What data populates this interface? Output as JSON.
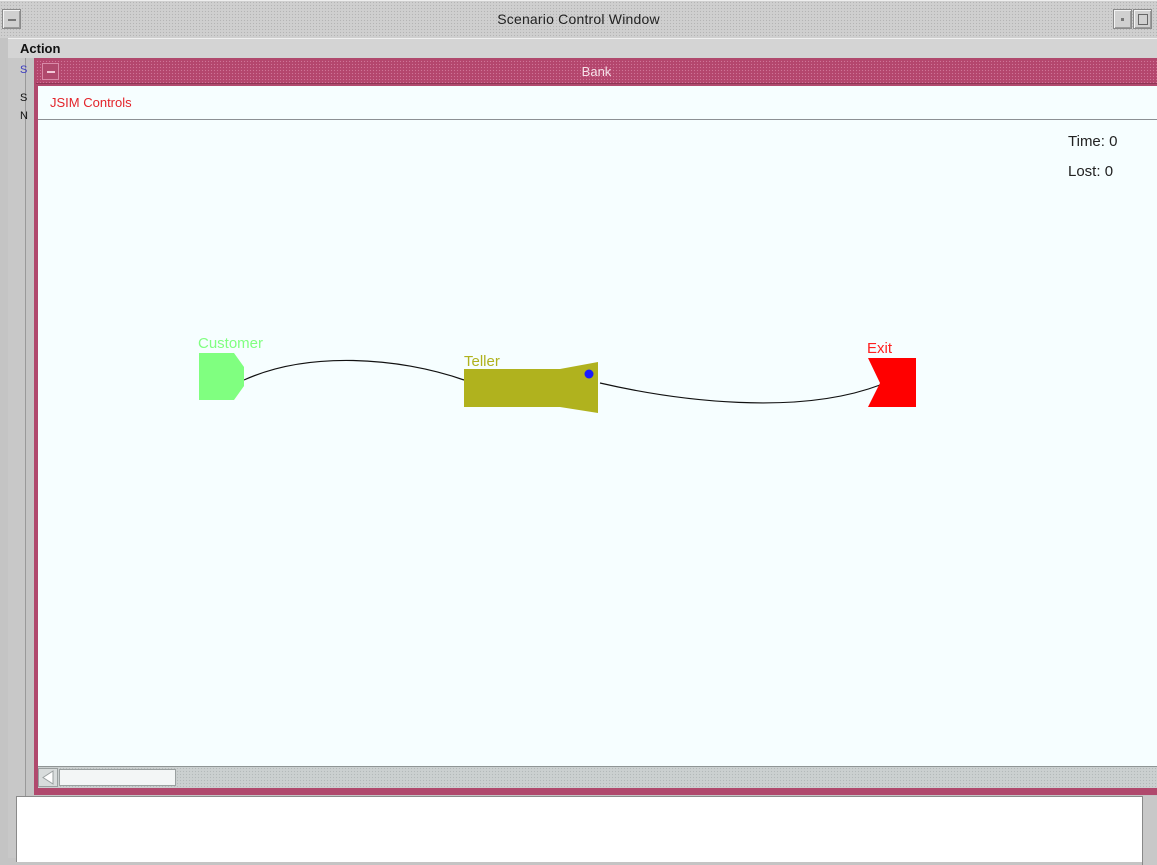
{
  "outer_window": {
    "title": "Scenario Control Window",
    "menu": {
      "action_label": "Action"
    },
    "left_strip_letters": [
      "S",
      "S",
      "N"
    ]
  },
  "inner_window": {
    "title": "Bank",
    "controls_label": "JSIM Controls",
    "stats": {
      "time_label": "Time:",
      "time_value": "0",
      "lost_label": "Lost:",
      "lost_value": "0"
    }
  },
  "model": {
    "customer": {
      "label": "Customer",
      "color": "#80ff80"
    },
    "teller": {
      "label": "Teller",
      "color": "#b0b21e"
    },
    "exit": {
      "label": "Exit",
      "color": "#ff0000"
    },
    "entity_color": "#1a1aff",
    "label_colors": {
      "customer": "#80ff80",
      "teller": "#b0b21e",
      "exit": "#ff2020"
    }
  }
}
